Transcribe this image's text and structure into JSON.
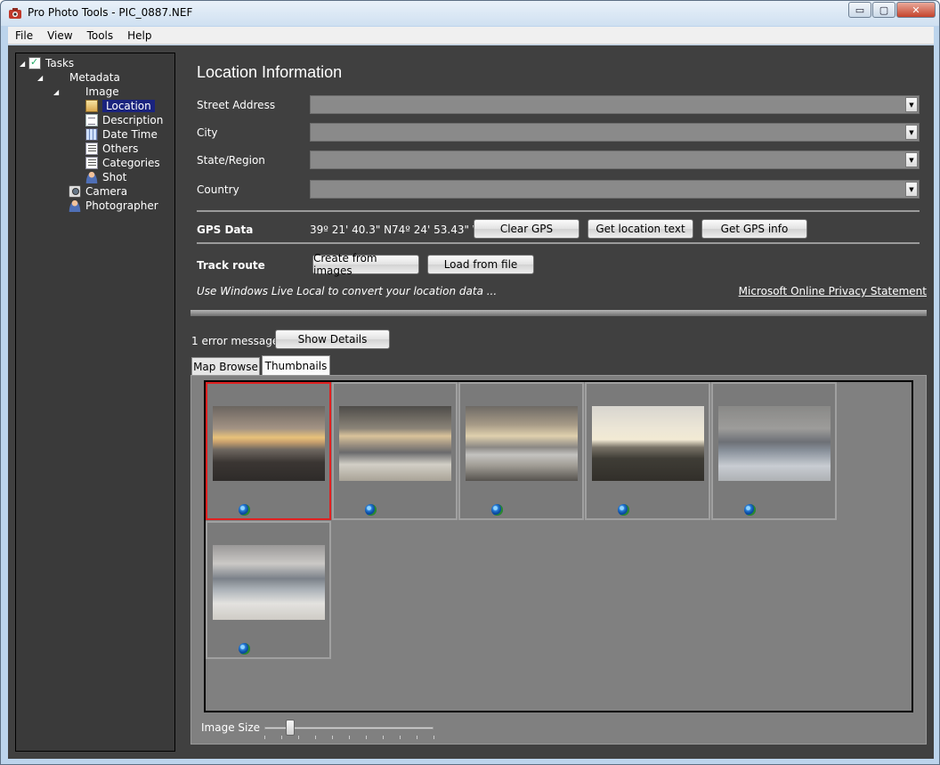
{
  "window": {
    "title": "Pro Photo Tools - PIC_0887.NEF",
    "controls": {
      "minimize": "▭",
      "maximize": "▢",
      "close": "✕"
    }
  },
  "menubar": {
    "items": [
      "File",
      "View",
      "Tools",
      "Help"
    ]
  },
  "tree": {
    "tasks": "Tasks",
    "metadata": "Metadata",
    "image": "Image",
    "location": "Location",
    "description": "Description",
    "date_time": "Date Time",
    "others": "Others",
    "categories": "Categories",
    "shot": "Shot",
    "camera": "Camera",
    "photographer": "Photographer"
  },
  "location": {
    "heading": "Location Information",
    "street_label": "Street Address",
    "city_label": "City",
    "state_label": "State/Region",
    "country_label": "Country",
    "street_value": "",
    "city_value": "",
    "state_value": "",
    "country_value": ""
  },
  "gps": {
    "label": "GPS Data",
    "latitude": "39º 21' 40.3\" N",
    "longitude": "74º 24' 53.43\" W",
    "clear_button": "Clear GPS",
    "location_text_button": "Get location text",
    "gps_info_button": "Get GPS info"
  },
  "track": {
    "label": "Track route",
    "create_button": "Create from images",
    "load_button": "Load from file"
  },
  "note": "Use Windows Live Local to convert your location data ...",
  "privacy_link": "Microsoft Online Privacy Statement",
  "errors": {
    "message": "1 error message.",
    "show_details_button": "Show Details"
  },
  "tabs": [
    "Map Browse",
    "Thumbnails"
  ],
  "active_tab": "Thumbnails",
  "thumbnails": {
    "count": 6,
    "selected_index": 0,
    "selected_border_color": "#e02020"
  },
  "image_size": {
    "label": "Image Size",
    "value": 0.15
  }
}
